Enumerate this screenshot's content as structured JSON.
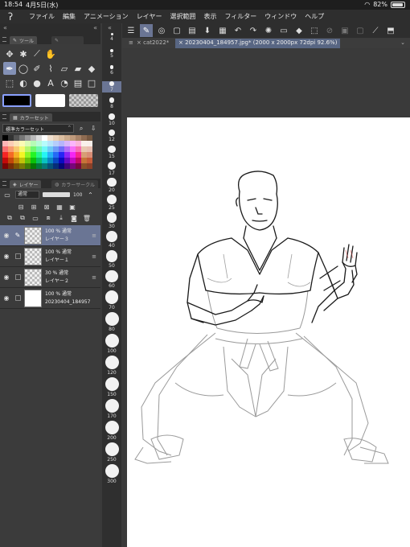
{
  "status_bar": {
    "time": "18:54",
    "date": "4月5日(水)",
    "battery": "82%",
    "battery_level": 0.82
  },
  "menu": [
    "ファイル",
    "編集",
    "アニメーション",
    "レイヤー",
    "選択範囲",
    "表示",
    "フィルター",
    "ウィンドウ",
    "ヘルプ"
  ],
  "tool_panel": {
    "tab_label": "ツール"
  },
  "color_set_panel": {
    "tab_label": "カラーセット",
    "selected_set": "標準カラーセット"
  },
  "layer_panel": {
    "tab_label": "レイヤー",
    "tab2_label": "カラーサークル",
    "blend_mode": "通常",
    "opacity": "100",
    "layers": [
      {
        "props": "100 % 通常",
        "name": "レイヤー３",
        "selected": true
      },
      {
        "props": "100 % 通常",
        "name": "レイヤー１",
        "selected": false
      },
      {
        "props": "30 % 通常",
        "name": "レイヤー２",
        "selected": false
      },
      {
        "props": "100 % 通常",
        "name": "20230404_184957",
        "selected": false
      }
    ]
  },
  "brush_sizes": [
    "4",
    "5",
    "6",
    "7",
    "8",
    "10",
    "12",
    "15",
    "17",
    "20",
    "25",
    "30",
    "40",
    "50",
    "60",
    "70",
    "80",
    "100",
    "120",
    "150",
    "170",
    "200",
    "250",
    "300"
  ],
  "brush_size_selected": "7",
  "doc_tabs": {
    "tab1": "cat2022*",
    "tab2": "20230404_184957.jpg* (2000 x 2000px 72dpi 92.6%)"
  },
  "colors": {
    "accent": "#6a7594",
    "panel": "#3b3b3b",
    "dark": "#2e2e2e"
  }
}
